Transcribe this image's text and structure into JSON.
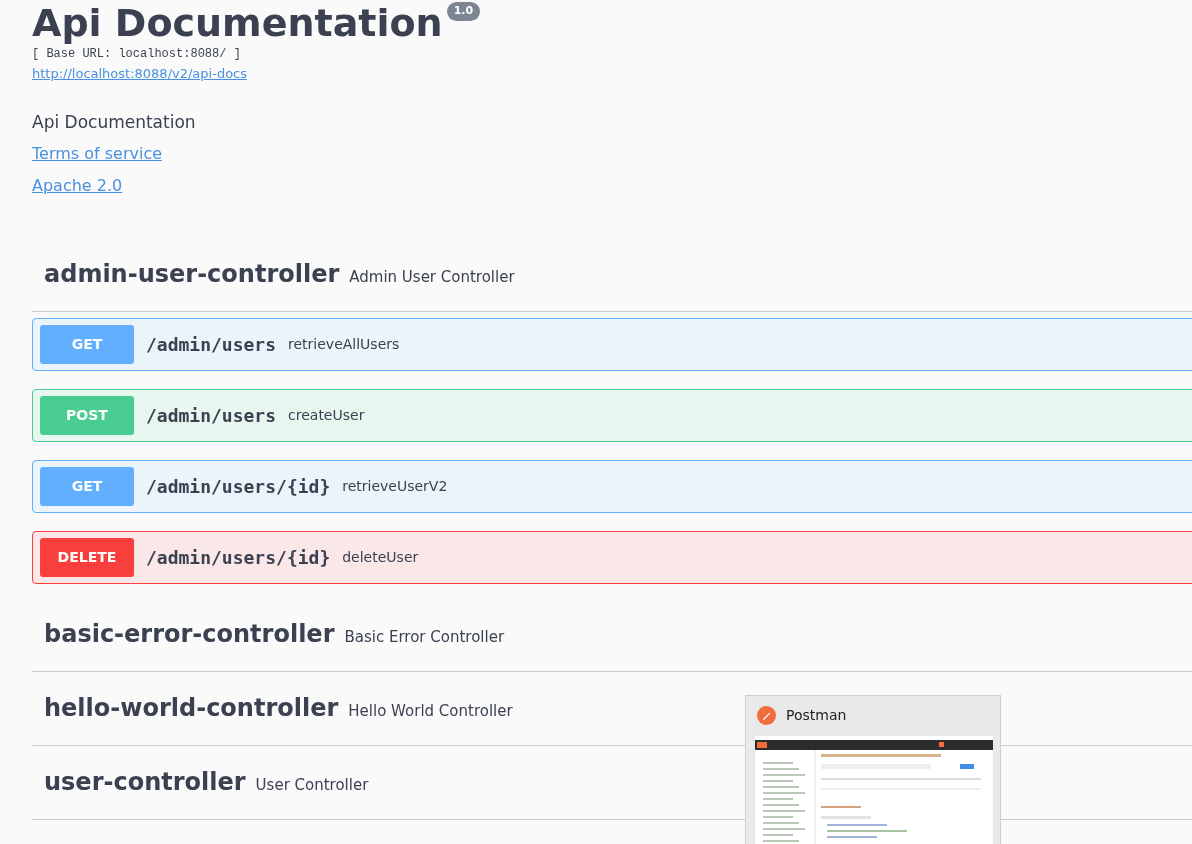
{
  "header": {
    "title": "Api Documentation",
    "version": "1.0",
    "base_url": "[ Base URL: localhost:8088/ ]",
    "docs_link": "http://localhost:8088/v2/api-docs",
    "description": "Api Documentation",
    "terms_link": "Terms of service",
    "license_link": "Apache 2.0"
  },
  "controllers": [
    {
      "name": "admin-user-controller",
      "description": "Admin User Controller",
      "operations": [
        {
          "method": "GET",
          "path": "/admin/users",
          "summary": "retrieveAllUsers"
        },
        {
          "method": "POST",
          "path": "/admin/users",
          "summary": "createUser"
        },
        {
          "method": "GET",
          "path": "/admin/users/{id}",
          "summary": "retrieveUserV2"
        },
        {
          "method": "DELETE",
          "path": "/admin/users/{id}",
          "summary": "deleteUser"
        }
      ]
    },
    {
      "name": "basic-error-controller",
      "description": "Basic Error Controller"
    },
    {
      "name": "hello-world-controller",
      "description": "Hello World Controller"
    },
    {
      "name": "user-controller",
      "description": "User Controller"
    }
  ],
  "taskbar_preview": {
    "title": "Postman"
  }
}
